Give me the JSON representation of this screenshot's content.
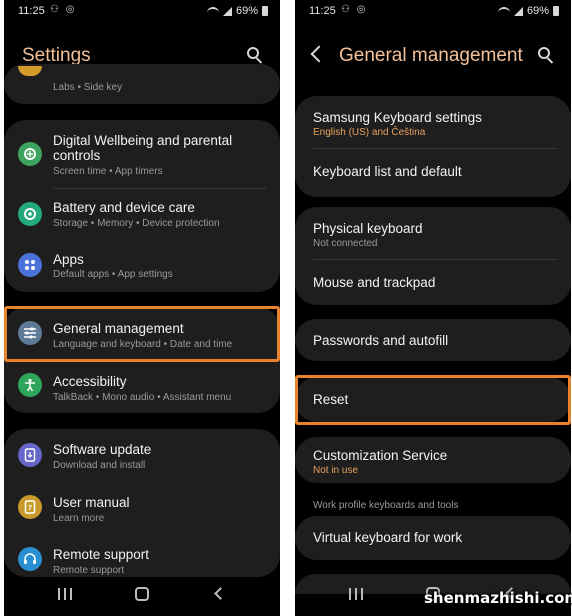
{
  "left_screen": {
    "status_bar": {
      "time": "11:25",
      "notif_icons": "⚇ ◎",
      "battery_pct": "69%"
    },
    "header": {
      "title": "Settings"
    },
    "partial_item": {
      "subtitle": "Labs  •  Side key"
    },
    "items": [
      {
        "title_line1": "Digital Wellbeing and parental",
        "title_line2": "controls",
        "subtitle": "Screen time  •  App timers",
        "icon": "digital-wellbeing-icon",
        "color": "#3ea35e"
      },
      {
        "title": "Battery and device care",
        "subtitle": "Storage  •  Memory  •  Device protection",
        "icon": "device-care-icon",
        "color": "#22a97e"
      },
      {
        "title": "Apps",
        "subtitle": "Default apps  •  App settings",
        "icon": "apps-icon",
        "color": "#4a73d9"
      },
      {
        "title": "General management",
        "subtitle": "Language and keyboard  •  Date and time",
        "icon": "sliders-icon",
        "color": "#5f7a96"
      },
      {
        "title": "Accessibility",
        "subtitle": "TalkBack  •  Mono audio  •  Assistant menu",
        "icon": "accessibility-icon",
        "color": "#2ea55a"
      },
      {
        "title": "Software update",
        "subtitle": "Download and install",
        "icon": "software-update-icon",
        "color": "#6566c9"
      },
      {
        "title": "User manual",
        "subtitle": "Learn more",
        "icon": "user-manual-icon",
        "color": "#c79a2b"
      },
      {
        "title": "Remote support",
        "subtitle": "Remote support",
        "icon": "headset-icon",
        "color": "#2a8fd1"
      }
    ]
  },
  "right_screen": {
    "status_bar": {
      "time": "11:25",
      "notif_icons": "⚇ ◎",
      "battery_pct": "69%"
    },
    "header": {
      "title": "General management"
    },
    "items": {
      "samsung_keyboard": {
        "title": "Samsung Keyboard settings",
        "subtitle": "English (US) and Čeština"
      },
      "keyboard_list": {
        "title": "Keyboard list and default"
      },
      "physical_keyboard": {
        "title": "Physical keyboard",
        "subtitle": "Not connected"
      },
      "mouse_trackpad": {
        "title": "Mouse and trackpad"
      },
      "passwords_autofill": {
        "title": "Passwords and autofill"
      },
      "reset": {
        "title": "Reset"
      },
      "customization": {
        "title": "Customization Service",
        "subtitle": "Not in use"
      },
      "work_profile_header": "Work profile keyboards and tools",
      "virtual_keyboard": {
        "title": "Virtual keyboard for work"
      }
    }
  },
  "colors": {
    "accent_title": "#f2c19a",
    "highlight": "#e9822c",
    "sub_accent": "#e8a15c"
  },
  "watermark": "shenmazhishi.com"
}
